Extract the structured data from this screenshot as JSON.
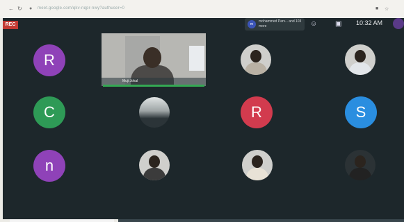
{
  "browser": {
    "url": "meet.google.com/qkv-nqpr-nwy?authuser=0",
    "back_icon": "back-arrow-icon",
    "reload_icon": "reload-icon",
    "lock_icon": "lock-icon"
  },
  "meeting": {
    "recording_badge": "REC",
    "presenter": {
      "avatar_initials": "m",
      "text": "mohammed Parv... and 103 more"
    },
    "clock": "10:32 AM",
    "video_tile": {
      "name": "Muji Jokal"
    },
    "participants": [
      {
        "initial": "R",
        "color": "#8f42b8"
      },
      {
        "initial": "C",
        "color": "#2e9a56"
      },
      {
        "initial": "R",
        "color": "#d23b4e"
      },
      {
        "initial": "S",
        "color": "#2a8ee0"
      },
      {
        "initial": "n",
        "color": "#8f42b8"
      }
    ]
  }
}
